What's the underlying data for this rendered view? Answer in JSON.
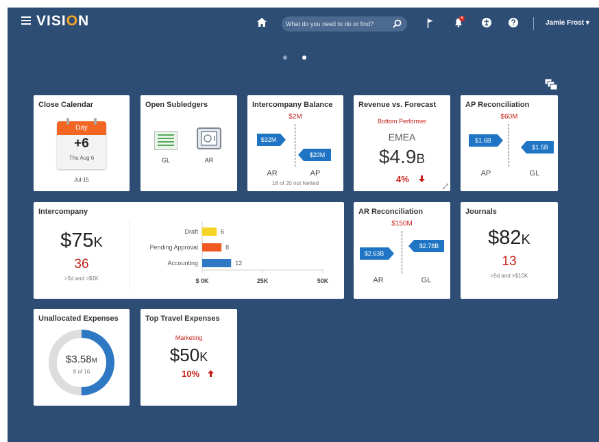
{
  "header": {
    "logo_pre": "VISI",
    "logo_o": "O",
    "logo_post": "N",
    "search_placeholder": "What do you need to do or find?",
    "notification_count": "6",
    "user_name": "Jamie Frost ▾"
  },
  "colors": {
    "background": "#2e4d74",
    "accent_blue": "#1f75c4",
    "alert_red": "#c41f17",
    "calendar_orange": "#f26522",
    "bar_yellow": "#f5d327",
    "bar_orange": "#f05a22",
    "bar_blue": "#2f78c4"
  },
  "cards": {
    "close_calendar": {
      "title": "Close Calendar",
      "day_label": "Day",
      "day_value": "+6",
      "date": "Thu Aug 6",
      "period": "Jul-15"
    },
    "open_subledgers": {
      "title": "Open Subledgers",
      "gl_label": "GL",
      "ar_label": "AR"
    },
    "intercompany_balance": {
      "title": "Intercompany Balance",
      "difference": "$2M",
      "ar_value": "$32M",
      "ap_value": "$20M",
      "ar_label": "AR",
      "ap_label": "AP",
      "note": "18 of 20 not Netted"
    },
    "revenue_forecast": {
      "title": "Revenue vs. Forecast",
      "subtitle": "Bottom Performer",
      "region": "EMEA",
      "value_num": "$4.9",
      "value_unit": "B",
      "change": "4%"
    },
    "ap_reconciliation": {
      "title": "AP Reconciliation",
      "difference": "$60M",
      "ap_value": "$1.6B",
      "gl_value": "$1.5B",
      "ap_label": "AP",
      "gl_label": "GL"
    },
    "intercompany": {
      "title": "Intercompany",
      "value_num": "$75",
      "value_unit": "K",
      "count": "36",
      "note": ">5d and >$1K"
    },
    "ar_reconciliation": {
      "title": "AR Reconciliation",
      "difference": "$150M",
      "ar_value": "$2.63B",
      "gl_value": "$2.78B",
      "ar_label": "AR",
      "gl_label": "GL"
    },
    "journals": {
      "title": "Journals",
      "value_num": "$82",
      "value_unit": "K",
      "count": "13",
      "note": ">5d and >$10K"
    },
    "unallocated_expenses": {
      "title": "Unallocated Expenses",
      "value_num": "$3.58",
      "value_unit": "M",
      "note": "8 of 16",
      "fraction": 0.5
    },
    "top_travel_expenses": {
      "title": "Top Travel Expenses",
      "subtitle": "Marketing",
      "value_num": "$50",
      "value_unit": "K",
      "change": "10%"
    }
  },
  "chart_data": {
    "type": "bar",
    "orientation": "horizontal",
    "categories": [
      "Draft",
      "Pending Approval",
      "Accounting"
    ],
    "values": [
      6,
      8,
      12
    ],
    "xlim": [
      0,
      50
    ],
    "x_ticks": [
      "$ 0K",
      "25K",
      "50K"
    ],
    "x_tick_values": [
      0,
      25,
      50
    ],
    "bar_colors": [
      "#f5d327",
      "#f05a22",
      "#2f78c4"
    ],
    "grid": false
  }
}
